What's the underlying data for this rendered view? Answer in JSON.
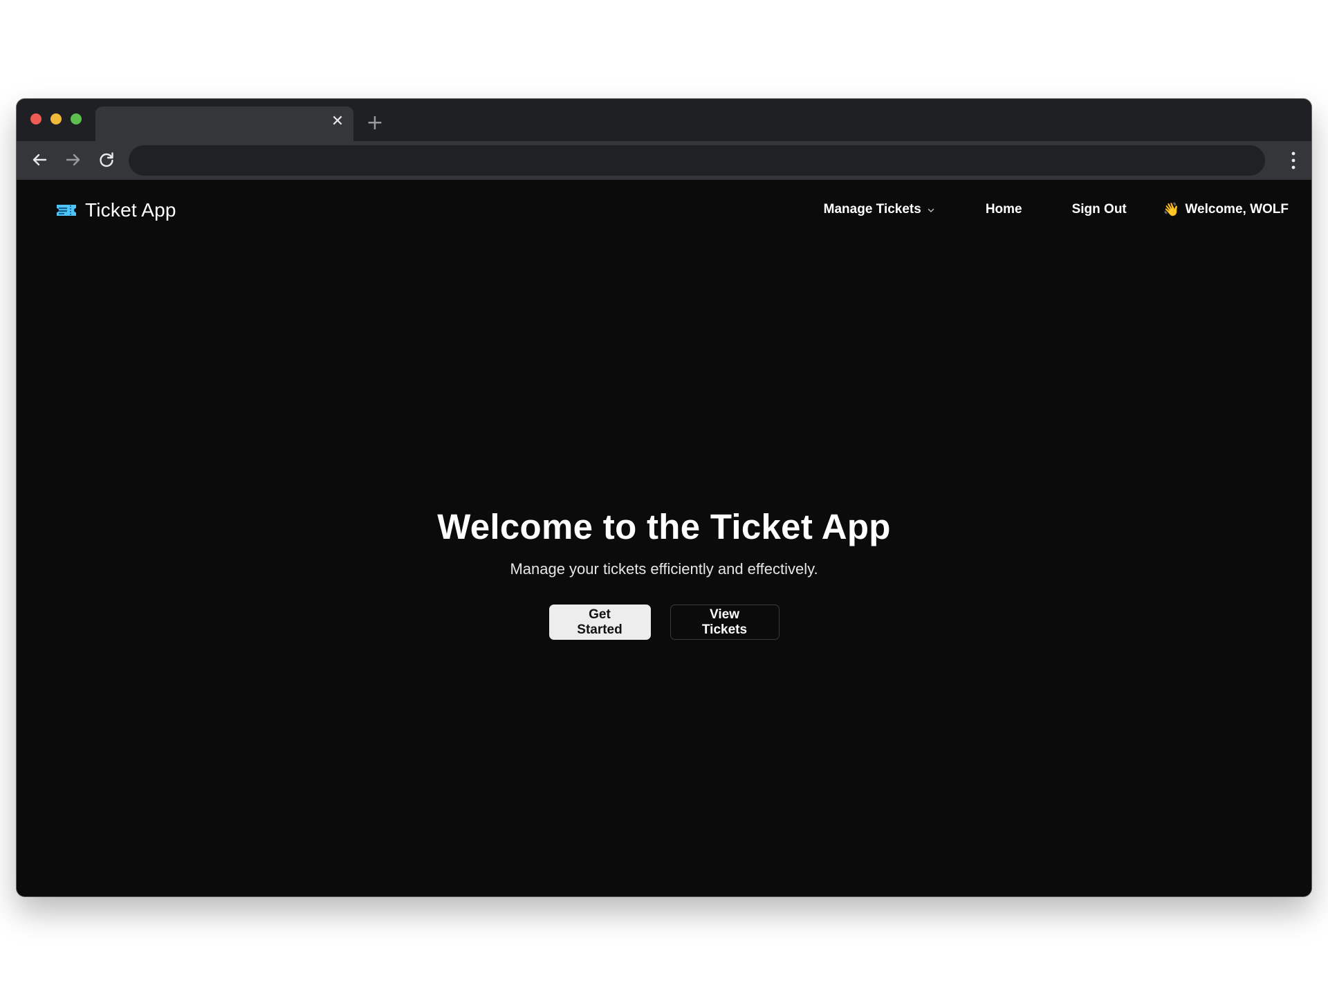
{
  "browser": {
    "tab_close_glyph": "✕",
    "new_tab_glyph": "+",
    "icons": [
      "back-arrow-icon",
      "forward-arrow-icon",
      "reload-icon",
      "more-vertical-icon"
    ]
  },
  "navbar": {
    "brand": "Ticket App",
    "brand_icon": "ticket-icon",
    "brand_icon_color": "#4fc3f7",
    "links": {
      "manage_tickets": "Manage Tickets",
      "home": "Home",
      "sign_out": "Sign Out",
      "welcome": "Welcome, WOLF",
      "welcome_icon": "👋"
    }
  },
  "hero": {
    "title": "Welcome to the Ticket App",
    "subtitle": "Manage your tickets efficiently and effectively.",
    "primary_button": "Get Started",
    "secondary_button": "View Tickets"
  },
  "colors": {
    "page_background": "#0b0b0c",
    "browser_frame": "#1f2023",
    "toolbar": "#35363a",
    "primary_button_bg": "#ededed"
  }
}
